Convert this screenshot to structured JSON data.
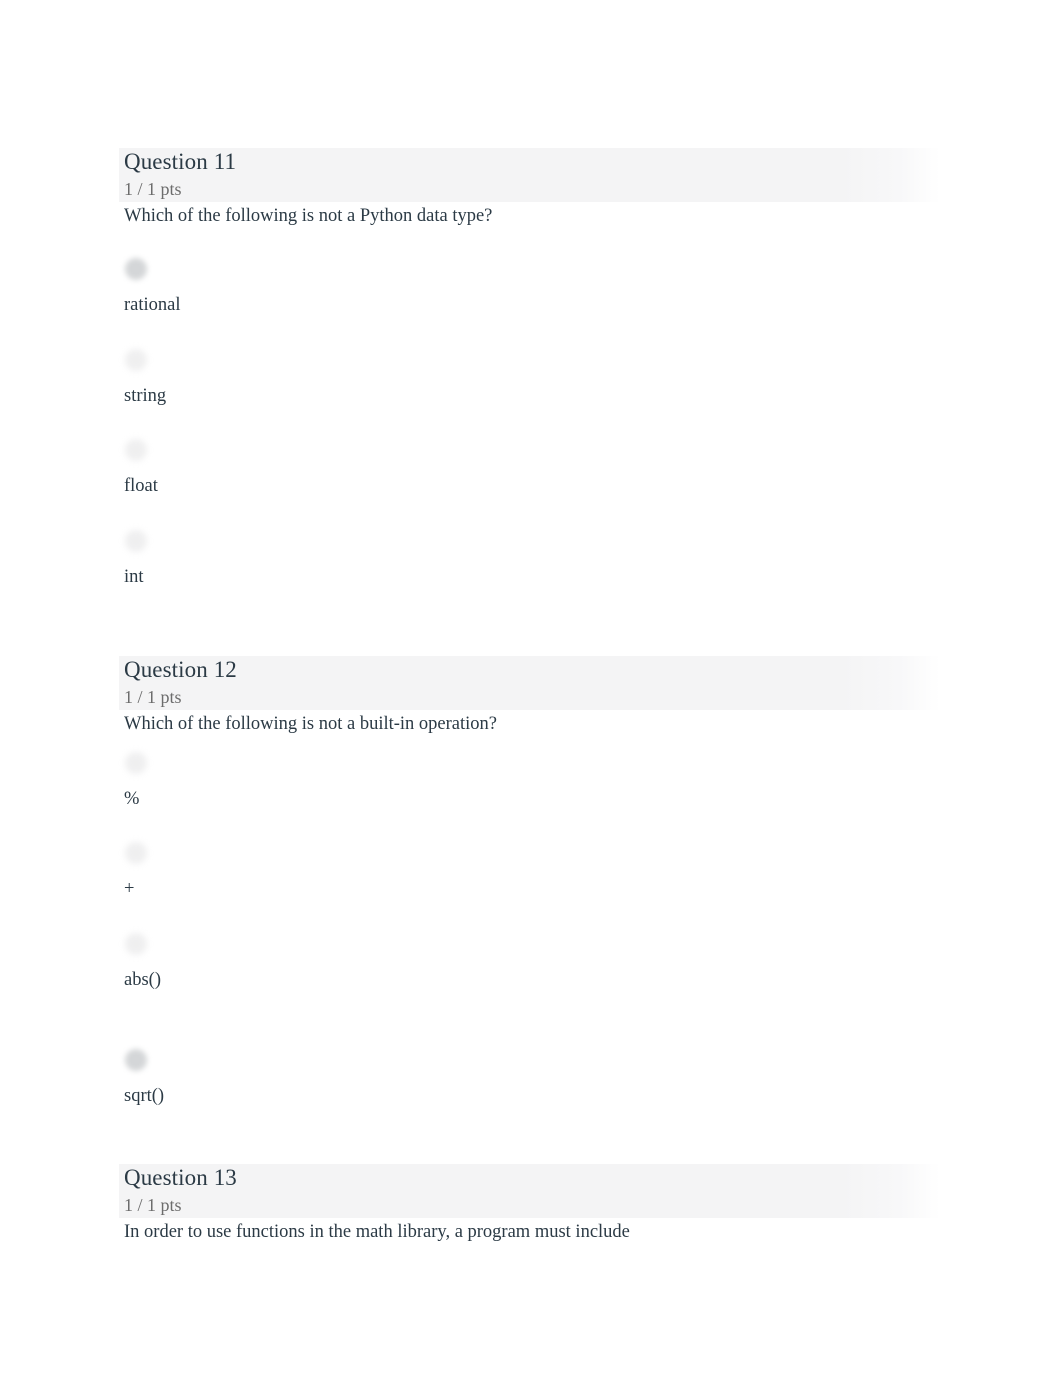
{
  "page": {
    "background_color": "#ffffff",
    "text_color": "#2b3a45",
    "muted_text_color": "#6c6c6c",
    "header_band_color": "#f4f4f5"
  },
  "questions": [
    {
      "title": "Question 11",
      "points": "1 / 1 pts",
      "text": "Which of the following is not a Python data type?",
      "answers": [
        {
          "label": "rational",
          "marker": "radio-button",
          "selected": true
        },
        {
          "label": "string",
          "marker": "radio-button",
          "selected": false
        },
        {
          "label": "float",
          "marker": "radio-button",
          "selected": false
        },
        {
          "label": "int",
          "marker": "radio-button",
          "selected": false
        }
      ]
    },
    {
      "title": "Question 12",
      "points": "1 / 1 pts",
      "text": "Which of the following is not a built-in operation?",
      "answers": [
        {
          "label": "%",
          "marker": "radio-button",
          "selected": false
        },
        {
          "label": "+",
          "marker": "radio-button",
          "selected": false
        },
        {
          "label": "abs()",
          "marker": "radio-button",
          "selected": false
        },
        {
          "label": "sqrt()",
          "marker": "radio-button",
          "selected": true
        }
      ]
    },
    {
      "title": "Question 13",
      "points": "1 / 1 pts",
      "text": "In order to use functions in the math library, a program must include",
      "answers": []
    }
  ]
}
